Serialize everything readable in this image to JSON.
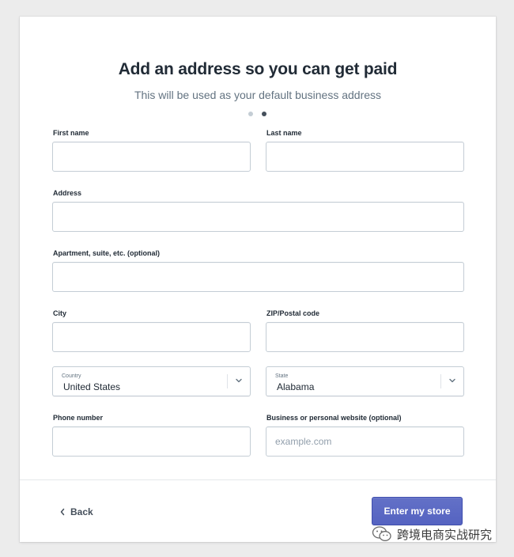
{
  "header": {
    "title": "Add an address so you can get paid",
    "subtitle": "This will be used as your default business address",
    "steps": {
      "total": 2,
      "current": 2
    }
  },
  "form": {
    "first_name": {
      "label": "First name",
      "value": ""
    },
    "last_name": {
      "label": "Last name",
      "value": ""
    },
    "address": {
      "label": "Address",
      "value": ""
    },
    "apartment": {
      "label": "Apartment, suite, etc. (optional)",
      "value": ""
    },
    "city": {
      "label": "City",
      "value": ""
    },
    "zip": {
      "label": "ZIP/Postal code",
      "value": ""
    },
    "country": {
      "label": "Country",
      "value": "United States"
    },
    "state": {
      "label": "State",
      "value": "Alabama"
    },
    "phone": {
      "label": "Phone number",
      "value": ""
    },
    "website": {
      "label": "Business or personal website (optional)",
      "placeholder": "example.com",
      "value": ""
    }
  },
  "footer": {
    "back_label": "Back",
    "submit_label": "Enter my store"
  },
  "watermark": {
    "text": "跨境电商实战研究"
  },
  "colors": {
    "background": "#ececec",
    "card": "#ffffff",
    "primary": "#5c6ac4",
    "text": "#212b36",
    "muted": "#637381",
    "border": "#c4cdd5"
  }
}
